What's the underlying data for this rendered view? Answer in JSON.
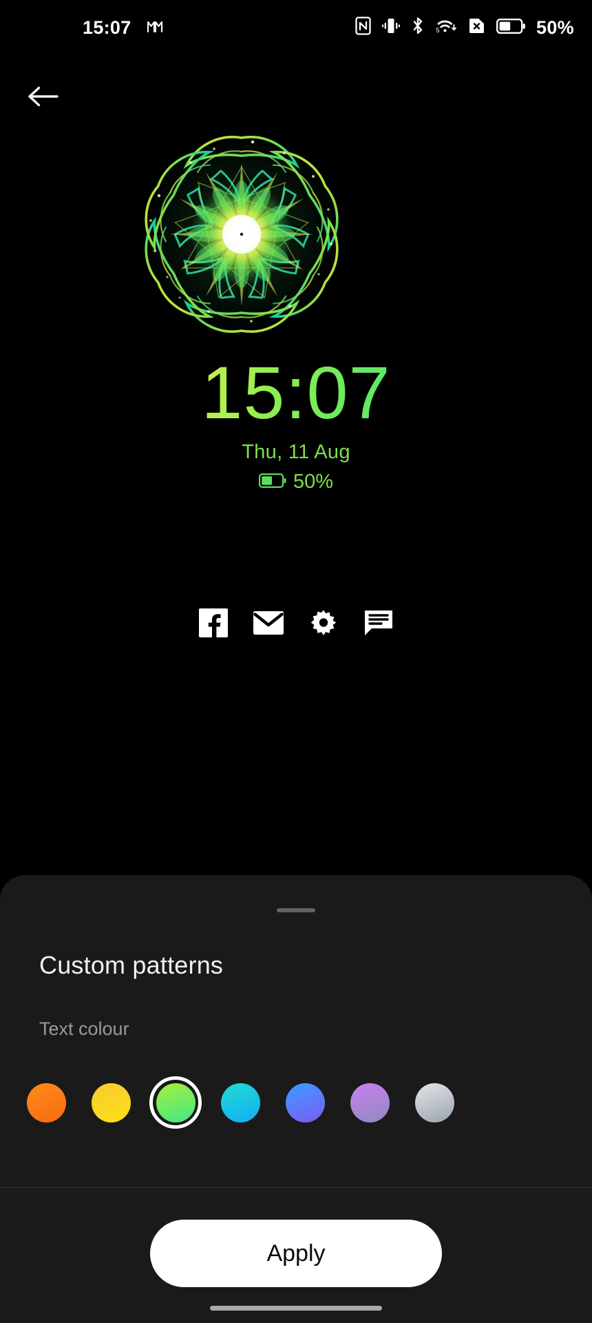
{
  "status_bar": {
    "time": "15:07",
    "battery_percent": "50%",
    "icons": [
      {
        "name": "gmail-icon",
        "label": "M"
      },
      {
        "name": "nfc-icon",
        "label": "NFC"
      },
      {
        "name": "vibrate-icon",
        "label": "Vibrate"
      },
      {
        "name": "bluetooth-icon",
        "label": "Bluetooth"
      },
      {
        "name": "wifi-icon",
        "label": "Wi-Fi 5"
      },
      {
        "name": "no-sim-icon",
        "label": "No SIM"
      },
      {
        "name": "battery-icon",
        "label": "Battery 50%"
      }
    ]
  },
  "navigation": {
    "back_label": "Back"
  },
  "preview": {
    "pattern_name": "Custom pattern preview",
    "clock": "15:07",
    "date": "Thu, 11 Aug",
    "battery": "50%",
    "text_colour_hex": "#7ce04a",
    "shortcuts": [
      {
        "name": "facebook-icon",
        "label": "Facebook"
      },
      {
        "name": "email-icon",
        "label": "Email"
      },
      {
        "name": "settings-gear-icon",
        "label": "Settings"
      },
      {
        "name": "messages-icon",
        "label": "Messages"
      }
    ]
  },
  "sheet": {
    "title": "Custom patterns",
    "section_label": "Text colour",
    "apply_label": "Apply",
    "selected_index": 2,
    "swatches": [
      {
        "name": "swatch-orange",
        "label": "Orange",
        "from": "#ff8c1a",
        "to": "#f96a10"
      },
      {
        "name": "swatch-yellow",
        "label": "Yellow",
        "from": "#fbc830",
        "to": "#fbe216"
      },
      {
        "name": "swatch-green",
        "label": "Green",
        "from": "#a8ef3c",
        "to": "#3fe884"
      },
      {
        "name": "swatch-cyan",
        "label": "Cyan",
        "from": "#1fdcd4",
        "to": "#13aef4"
      },
      {
        "name": "swatch-blue",
        "label": "Blue",
        "from": "#3e9bff",
        "to": "#7a5cf5"
      },
      {
        "name": "swatch-purple",
        "label": "Purple",
        "from": "#cb7ff0",
        "to": "#8f8bbd"
      },
      {
        "name": "swatch-silver",
        "label": "Silver",
        "from": "#e3e6ea",
        "to": "#9aa3ad"
      }
    ]
  }
}
